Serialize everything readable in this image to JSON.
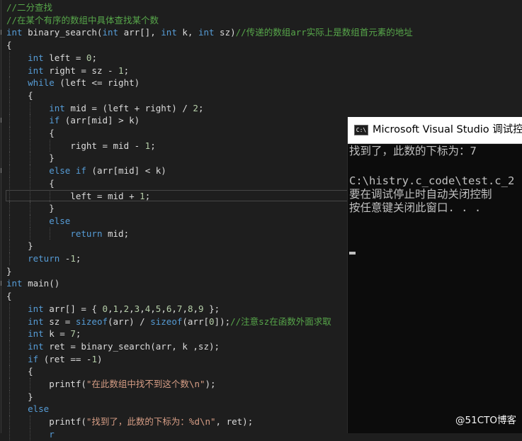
{
  "editor": {
    "lines": [
      [
        {
          "t": "//二分查找",
          "c": "c"
        }
      ],
      [
        {
          "t": "//在某个有序的数组中具体查找某个数",
          "c": "c"
        }
      ],
      [
        {
          "t": "int",
          "c": "k"
        },
        {
          "t": " binary_search(",
          "c": "p"
        },
        {
          "t": "int",
          "c": "k"
        },
        {
          "t": " arr[], ",
          "c": "p"
        },
        {
          "t": "int",
          "c": "k"
        },
        {
          "t": " k, ",
          "c": "p"
        },
        {
          "t": "int",
          "c": "k"
        },
        {
          "t": " sz)",
          "c": "p"
        },
        {
          "t": "//传递的数组arr实际上是数组首元素的地址",
          "c": "c"
        }
      ],
      [
        {
          "t": "{",
          "c": "p"
        }
      ],
      [
        {
          "t": "    ",
          "c": "p"
        },
        {
          "t": "int",
          "c": "k"
        },
        {
          "t": " left = ",
          "c": "p"
        },
        {
          "t": "0",
          "c": "n"
        },
        {
          "t": ";",
          "c": "p"
        }
      ],
      [
        {
          "t": "    ",
          "c": "p"
        },
        {
          "t": "int",
          "c": "k"
        },
        {
          "t": " right = sz - ",
          "c": "p"
        },
        {
          "t": "1",
          "c": "n"
        },
        {
          "t": ";",
          "c": "p"
        }
      ],
      [
        {
          "t": "    ",
          "c": "p"
        },
        {
          "t": "while",
          "c": "k"
        },
        {
          "t": " (left <= right)",
          "c": "p"
        }
      ],
      [
        {
          "t": "    {",
          "c": "p"
        }
      ],
      [
        {
          "t": "        ",
          "c": "p"
        },
        {
          "t": "int",
          "c": "k"
        },
        {
          "t": " mid = (left + right) / ",
          "c": "p"
        },
        {
          "t": "2",
          "c": "n"
        },
        {
          "t": ";",
          "c": "p"
        }
      ],
      [
        {
          "t": "        ",
          "c": "p"
        },
        {
          "t": "if",
          "c": "k"
        },
        {
          "t": " (arr[mid] > k)",
          "c": "p"
        }
      ],
      [
        {
          "t": "        {",
          "c": "p"
        }
      ],
      [
        {
          "t": "            right = mid - ",
          "c": "p"
        },
        {
          "t": "1",
          "c": "n"
        },
        {
          "t": ";",
          "c": "p"
        }
      ],
      [
        {
          "t": "        }",
          "c": "p"
        }
      ],
      [
        {
          "t": "        ",
          "c": "p"
        },
        {
          "t": "else if",
          "c": "k"
        },
        {
          "t": " (arr[mid] < k)",
          "c": "p"
        }
      ],
      [
        {
          "t": "        {",
          "c": "p"
        }
      ],
      [
        {
          "t": "            left = mid + ",
          "c": "p"
        },
        {
          "t": "1",
          "c": "n"
        },
        {
          "t": ";",
          "c": "p"
        }
      ],
      [
        {
          "t": "        }",
          "c": "p"
        }
      ],
      [
        {
          "t": "        ",
          "c": "p"
        },
        {
          "t": "else",
          "c": "k"
        }
      ],
      [
        {
          "t": "            ",
          "c": "p"
        },
        {
          "t": "return",
          "c": "k"
        },
        {
          "t": " mid;",
          "c": "p"
        }
      ],
      [
        {
          "t": "    }",
          "c": "p"
        }
      ],
      [
        {
          "t": "    ",
          "c": "p"
        },
        {
          "t": "return",
          "c": "k"
        },
        {
          "t": " -",
          "c": "p"
        },
        {
          "t": "1",
          "c": "n"
        },
        {
          "t": ";",
          "c": "p"
        }
      ],
      [
        {
          "t": "}",
          "c": "p"
        }
      ],
      [
        {
          "t": "int",
          "c": "k"
        },
        {
          "t": " main()",
          "c": "p"
        }
      ],
      [
        {
          "t": "{",
          "c": "p"
        }
      ],
      [
        {
          "t": "    ",
          "c": "p"
        },
        {
          "t": "int",
          "c": "k"
        },
        {
          "t": " arr[] = { ",
          "c": "p"
        },
        {
          "t": "0",
          "c": "n"
        },
        {
          "t": ",",
          "c": "p"
        },
        {
          "t": "1",
          "c": "n"
        },
        {
          "t": ",",
          "c": "p"
        },
        {
          "t": "2",
          "c": "n"
        },
        {
          "t": ",",
          "c": "p"
        },
        {
          "t": "3",
          "c": "n"
        },
        {
          "t": ",",
          "c": "p"
        },
        {
          "t": "4",
          "c": "n"
        },
        {
          "t": ",",
          "c": "p"
        },
        {
          "t": "5",
          "c": "n"
        },
        {
          "t": ",",
          "c": "p"
        },
        {
          "t": "6",
          "c": "n"
        },
        {
          "t": ",",
          "c": "p"
        },
        {
          "t": "7",
          "c": "n"
        },
        {
          "t": ",",
          "c": "p"
        },
        {
          "t": "8",
          "c": "n"
        },
        {
          "t": ",",
          "c": "p"
        },
        {
          "t": "9",
          "c": "n"
        },
        {
          "t": " };",
          "c": "p"
        }
      ],
      [
        {
          "t": "    ",
          "c": "p"
        },
        {
          "t": "int",
          "c": "k"
        },
        {
          "t": " sz = ",
          "c": "p"
        },
        {
          "t": "sizeof",
          "c": "k"
        },
        {
          "t": "(arr) / ",
          "c": "p"
        },
        {
          "t": "sizeof",
          "c": "k"
        },
        {
          "t": "(arr[",
          "c": "p"
        },
        {
          "t": "0",
          "c": "n"
        },
        {
          "t": "]);",
          "c": "p"
        },
        {
          "t": "//注意sz在函数外面求取",
          "c": "c"
        }
      ],
      [
        {
          "t": "    ",
          "c": "p"
        },
        {
          "t": "int",
          "c": "k"
        },
        {
          "t": " k = ",
          "c": "p"
        },
        {
          "t": "7",
          "c": "n"
        },
        {
          "t": ";",
          "c": "p"
        }
      ],
      [
        {
          "t": "    ",
          "c": "p"
        },
        {
          "t": "int",
          "c": "k"
        },
        {
          "t": " ret = binary_search(arr, k ,sz);",
          "c": "p"
        }
      ],
      [
        {
          "t": "    ",
          "c": "p"
        },
        {
          "t": "if",
          "c": "k"
        },
        {
          "t": " (ret == -",
          "c": "p"
        },
        {
          "t": "1",
          "c": "n"
        },
        {
          "t": ")",
          "c": "p"
        }
      ],
      [
        {
          "t": "    {",
          "c": "p"
        }
      ],
      [
        {
          "t": "        printf(",
          "c": "p"
        },
        {
          "t": "\"在此数组中找不到这个数\\n\"",
          "c": "s"
        },
        {
          "t": ");",
          "c": "p"
        }
      ],
      [
        {
          "t": "    }",
          "c": "p"
        }
      ],
      [
        {
          "t": "    ",
          "c": "p"
        },
        {
          "t": "else",
          "c": "k"
        }
      ],
      [
        {
          "t": "        printf(",
          "c": "p"
        },
        {
          "t": "\"找到了，此数的下标为：%d\\n\"",
          "c": "s"
        },
        {
          "t": ", ret);",
          "c": "p"
        }
      ],
      [
        {
          "t": "        ",
          "c": "p"
        },
        {
          "t": "r",
          "c": "k"
        }
      ]
    ],
    "fold_lines": [
      2,
      9,
      13,
      22
    ],
    "highlight_line": 15
  },
  "console": {
    "title": "Microsoft Visual Studio 调试控制台",
    "lines": [
      "找到了，此数的下标为：7",
      "",
      "C:\\histry.c_code\\test.c_2",
      "要在调试停止时自动关闭控制",
      "按任意键关闭此窗口. . ."
    ]
  },
  "watermark": "@51CTO博客"
}
